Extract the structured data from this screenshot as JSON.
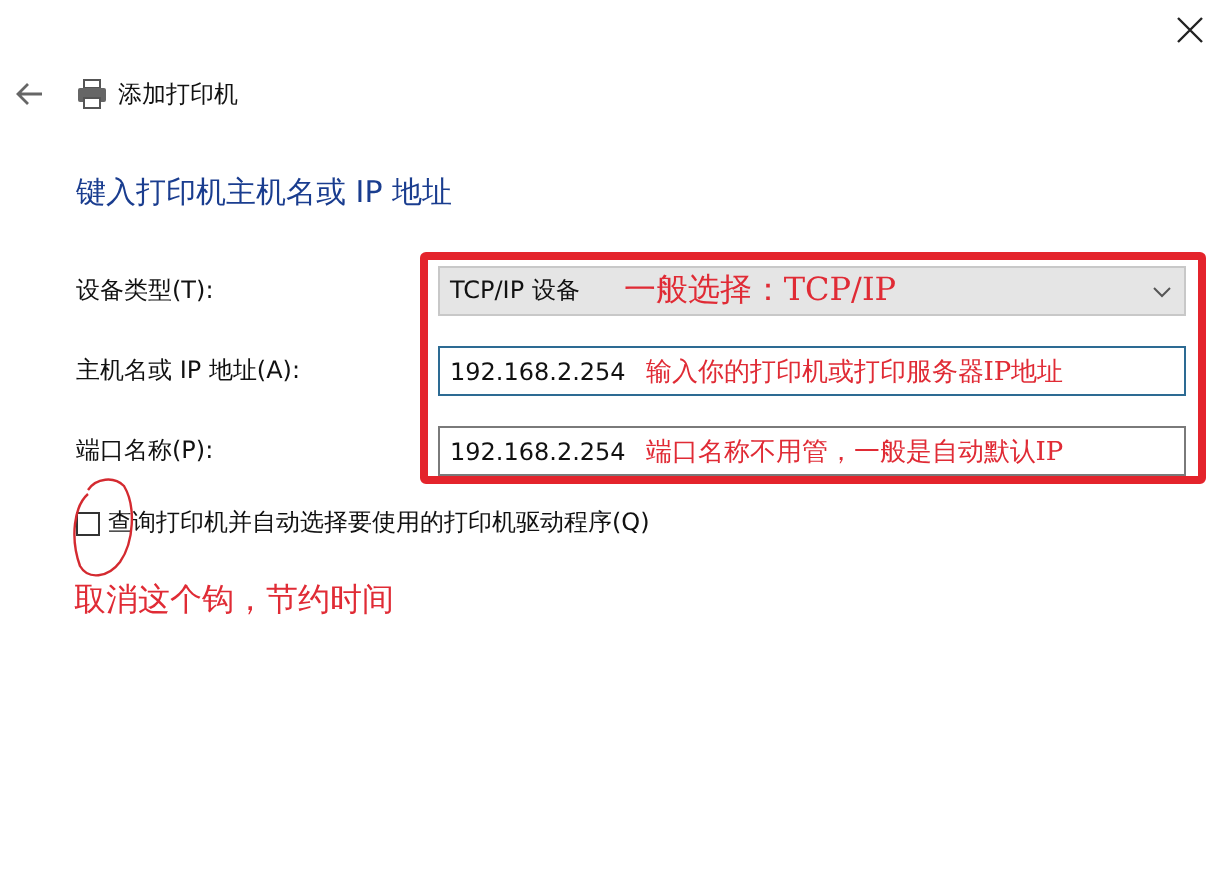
{
  "window": {
    "title": "添加打印机"
  },
  "heading": "键入打印机主机名或 IP 地址",
  "fields": [
    {
      "kind": "dropdown",
      "label": "设备类型(T):",
      "value": "TCP/IP 设备",
      "annotation": "一般选择：TCP/IP"
    },
    {
      "kind": "text",
      "label": "主机名或 IP 地址(A):",
      "value": "192.168.2.254",
      "annotation": "输入你的打印机或打印服务器IP地址"
    },
    {
      "kind": "text",
      "label": "端口名称(P):",
      "value": "192.168.2.254",
      "annotation": "端口名称不用管，一般是自动默认IP"
    }
  ],
  "checkbox": {
    "label": "查询打印机并自动选择要使用的打印机驱动程序(Q)",
    "checked": false
  },
  "note": "取消这个钩，节约时间"
}
